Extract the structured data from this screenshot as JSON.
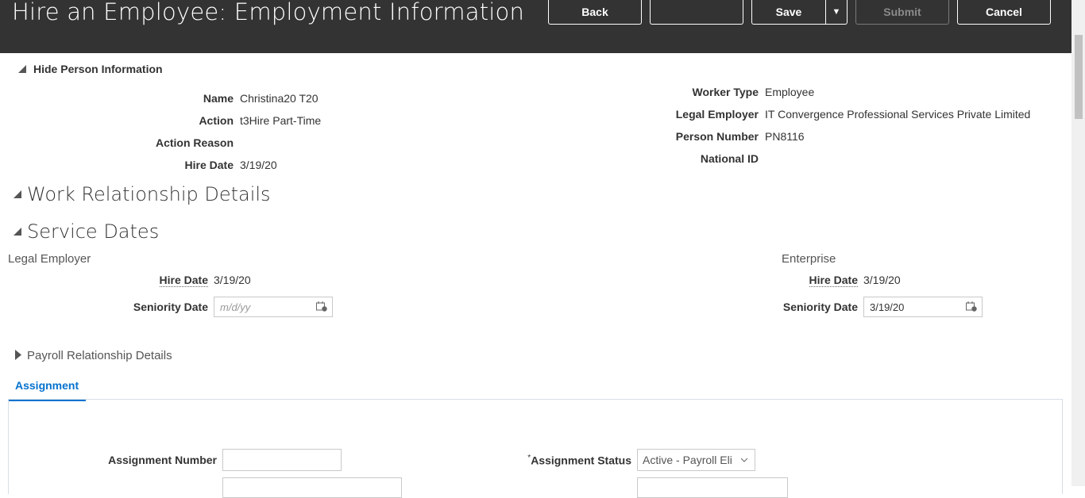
{
  "header": {
    "title": "Hire an Employee: Employment Information",
    "back_label": "Back",
    "blank_label": "",
    "save_label": "Save",
    "submit_label": "Submit",
    "cancel_label": "Cancel"
  },
  "person_info": {
    "toggle_label": "Hide Person Information",
    "left": [
      {
        "label": "Name",
        "value": "Christina20 T20"
      },
      {
        "label": "Action",
        "value": "t3Hire Part-Time"
      },
      {
        "label": "Action Reason",
        "value": ""
      },
      {
        "label": "Hire Date",
        "value": "3/19/20"
      }
    ],
    "right": [
      {
        "label": "Worker Type",
        "value": "Employee"
      },
      {
        "label": "Legal Employer",
        "value": "IT Convergence Professional Services Private Limited"
      },
      {
        "label": "Person Number",
        "value": "PN8116"
      },
      {
        "label": "National ID",
        "value": ""
      }
    ]
  },
  "work_relationship": {
    "title": "Work Relationship Details"
  },
  "service_dates": {
    "title": "Service Dates",
    "legal_employer": {
      "heading": "Legal Employer",
      "hire_date_label": "Hire Date",
      "hire_date": "3/19/20",
      "seniority_label": "Seniority Date",
      "seniority_placeholder": "m/d/yy",
      "seniority_value": ""
    },
    "enterprise": {
      "heading": "Enterprise",
      "hire_date_label": "Hire Date",
      "hire_date": "3/19/20",
      "seniority_label": "Seniority Date",
      "seniority_value": "3/19/20"
    }
  },
  "payroll": {
    "title": "Payroll Relationship Details"
  },
  "assignment": {
    "tab_label": "Assignment",
    "number_label": "Assignment Number",
    "number_value": "",
    "status_label": "Assignment Status",
    "status_value": "Active - Payroll Eli",
    "required_mark": "*"
  },
  "colors": {
    "header_bg": "#333333",
    "accent": "#0572ce"
  },
  "icons": [
    "calendar-icon",
    "chevron-down-icon",
    "triangle-expanded-icon",
    "triangle-collapsed-icon"
  ]
}
